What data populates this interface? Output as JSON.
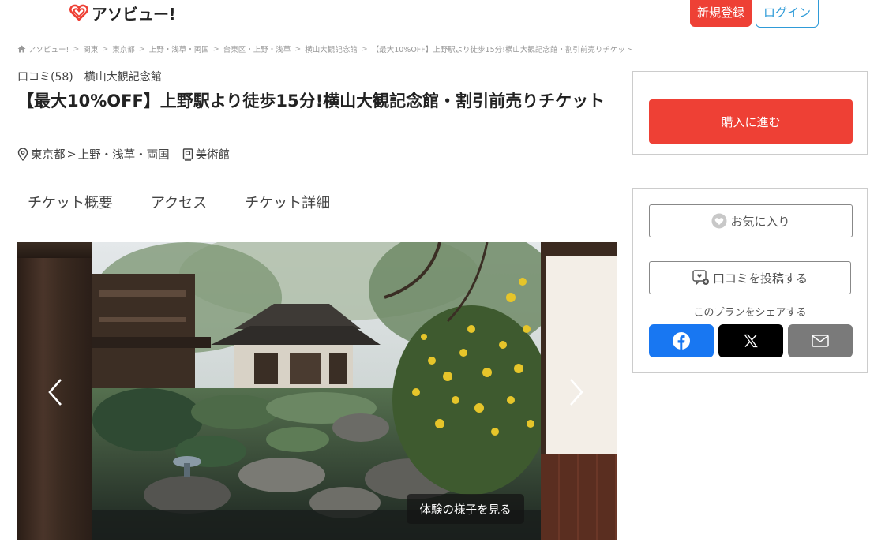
{
  "header": {
    "logo_text": "アソビュー!",
    "signup_label": "新規登録",
    "login_label": "ログイン",
    "accent_color": "#ee4035",
    "login_color": "#2f9bd8"
  },
  "breadcrumb": [
    "アソビュー!",
    "関東",
    "東京都",
    "上野・浅草・両国",
    "台東区・上野・浅草",
    "横山大観記念館",
    "【最大10%OFF】上野駅より徒歩15分!横山大観記念館・割引前売りチケット"
  ],
  "product": {
    "review_count": "口コミ(58)",
    "facility_name": "横山大観記念館",
    "title": "【最大10%OFF】上野駅より徒歩15分!横山大観記念館・割引前売りチケット",
    "prefecture": "東京都",
    "area": "上野・浅草・両国",
    "category": "美術館"
  },
  "tabs": [
    "チケット概要",
    "アクセス",
    "チケット詳細"
  ],
  "gallery": {
    "view_button_label": "体験の様子を見る"
  },
  "sidebar": {
    "buy_label": "購入に進む",
    "favorite_label": "お気に入り",
    "review_label": "口コミを投稿する",
    "share_label": "このプランをシェアする",
    "share_icons": [
      "facebook-icon",
      "x-icon",
      "mail-icon"
    ]
  }
}
